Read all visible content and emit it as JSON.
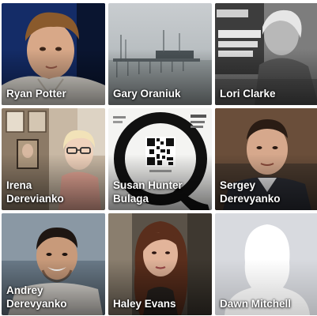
{
  "friends": [
    {
      "id": "ryan",
      "lines": [
        "Ryan Potter"
      ],
      "photo": "portrait-blue-backdrop"
    },
    {
      "id": "gary",
      "lines": [
        "Gary Oraniuk"
      ],
      "photo": "pier-seascape"
    },
    {
      "id": "lori",
      "lines": [
        "Lori Clarke"
      ],
      "photo": "bw-portrait-signs"
    },
    {
      "id": "irena",
      "lines": [
        "Irena",
        "Derevianko"
      ],
      "photo": "woman-glasses-room"
    },
    {
      "id": "susan",
      "lines": [
        "Susan Hunter",
        "Bulaga"
      ],
      "photo": "q-logo-qr-code"
    },
    {
      "id": "sergey",
      "lines": [
        "Sergey",
        "Derevyanko"
      ],
      "photo": "man-dark-backdrop"
    },
    {
      "id": "andrey",
      "lines": [
        "Andrey",
        "Derevyanko"
      ],
      "photo": "man-smiling"
    },
    {
      "id": "haley",
      "lines": [
        "Haley Evans"
      ],
      "photo": "woman-brown-hair"
    },
    {
      "id": "dawn",
      "lines": [
        "Dawn Mitchell"
      ],
      "photo": "default-avatar-silhouette"
    }
  ],
  "colors": {
    "name_text": "#ffffff",
    "default_avatar_bg": "#d8dadf",
    "default_avatar_fg": "#ffffff"
  }
}
